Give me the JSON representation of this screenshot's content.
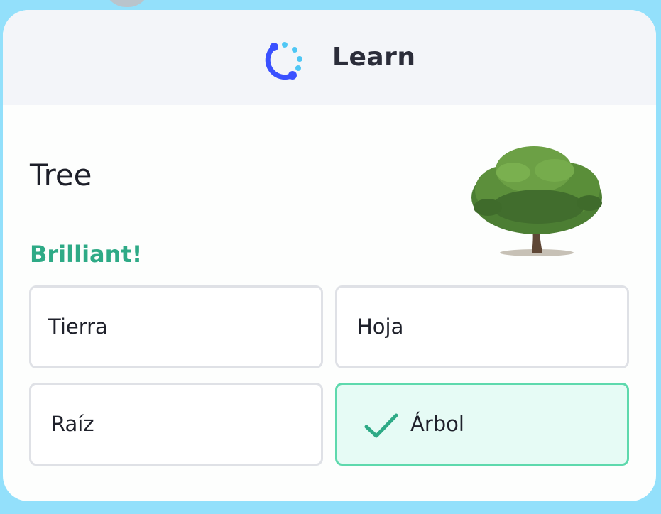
{
  "app": {
    "title": "Learn",
    "accent_color": "#3b5bfd",
    "success_color": "#2eaa86"
  },
  "exercise": {
    "word": "Tree",
    "image_icon": "tree-icon",
    "feedback": "Brilliant!",
    "options": [
      {
        "label": "Tierra",
        "state": "default"
      },
      {
        "label": "Hoja",
        "state": "default"
      },
      {
        "label": "Raíz",
        "state": "default"
      },
      {
        "label": "Árbol",
        "state": "correct"
      }
    ]
  }
}
